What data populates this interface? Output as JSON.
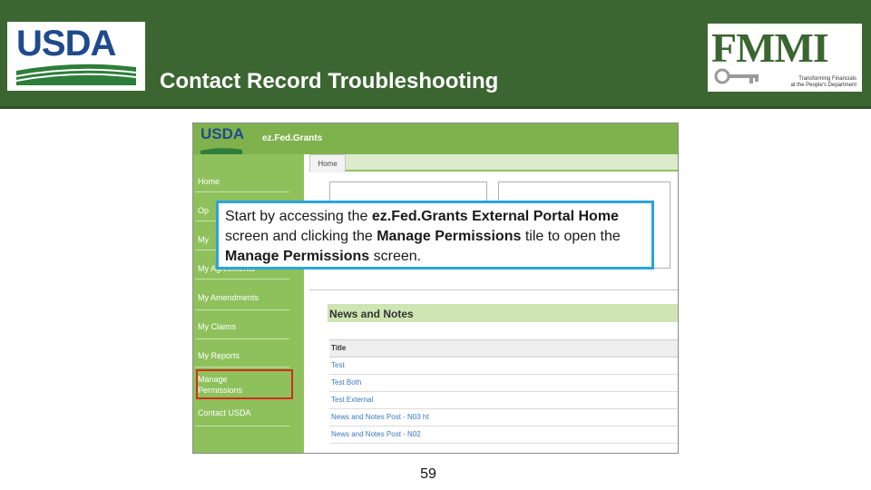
{
  "header": {
    "usda_logo_text": "USDA",
    "fmmi_logo_text": "FMMI",
    "fmmi_tagline_line1": "Transforming Financials",
    "fmmi_tagline_line2": "at the People's Department",
    "title": "Contact Record Troubleshooting"
  },
  "screenshot": {
    "logo_text": "USDA",
    "app_name": "ez.Fed.Grants",
    "home_tab": "Home",
    "sidebar": {
      "items": [
        {
          "label": "Home"
        },
        {
          "label": "Op"
        },
        {
          "label": "My"
        },
        {
          "label": "My Agreements"
        },
        {
          "label": "My Amendments"
        },
        {
          "label": "My Claims"
        },
        {
          "label": "My Reports"
        },
        {
          "label": "Manage Permissions"
        },
        {
          "label": "Contact USDA"
        }
      ],
      "highlighted": "Manage Permissions",
      "highlight_color": "#d32a1f"
    },
    "news": {
      "title": "News and Notes",
      "column_header": "Title",
      "rows": [
        "Test",
        "Test Both",
        "Test External",
        "News and Notes Post - N03 ht",
        "News and Notes Post - N02"
      ]
    }
  },
  "callout": {
    "segments": [
      {
        "text": "Start by accessing the ",
        "bold": false
      },
      {
        "text": "ez.Fed.Grants External Portal Home",
        "bold": true
      },
      {
        "text": " screen and clicking the ",
        "bold": false
      },
      {
        "text": "Manage Permissions",
        "bold": true
      },
      {
        "text": " tile to open the ",
        "bold": false
      },
      {
        "text": "Manage Permissions",
        "bold": true
      },
      {
        "text": " screen.",
        "bold": false
      }
    ],
    "border_color": "#2aa4dd"
  },
  "page_number": "59",
  "colors": {
    "header_green": "#3b6631",
    "app_green": "#8ec15c",
    "link_blue": "#3a78c0"
  }
}
